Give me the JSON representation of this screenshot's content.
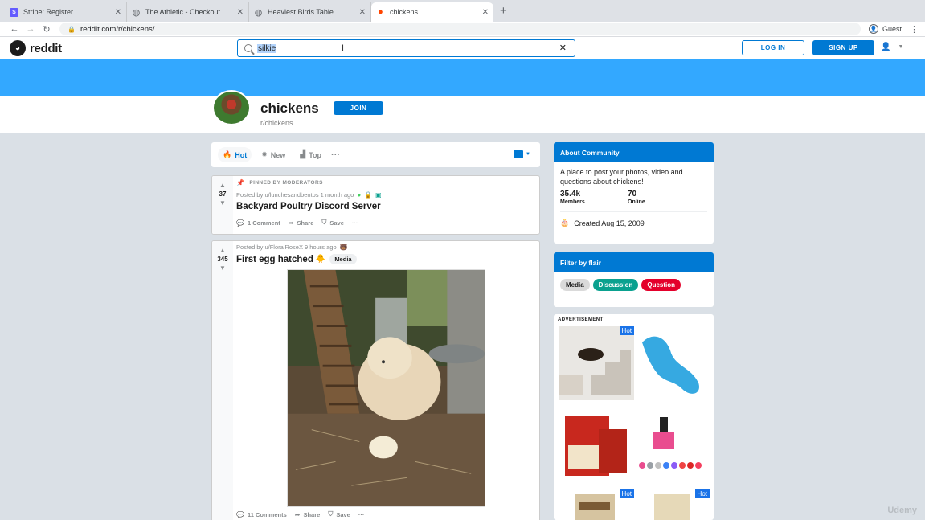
{
  "browser": {
    "tabs": [
      {
        "title": "Stripe: Register",
        "favicon_color": "#635bff",
        "favicon_glyph": "S"
      },
      {
        "title": "The Athletic - Checkout",
        "favicon_color": "#5f6368",
        "favicon_glyph": "◍"
      },
      {
        "title": "Heaviest Birds Table",
        "favicon_color": "#5f6368",
        "favicon_glyph": "◍"
      },
      {
        "title": "chickens",
        "favicon_color": "#ff4500",
        "favicon_glyph": "●",
        "active": true
      }
    ],
    "url": "reddit.com/r/chickens/",
    "profile_label": "Guest"
  },
  "reddit": {
    "logo_text": "reddit",
    "search_value": "silkie",
    "login_label": "LOG IN",
    "signup_label": "SIGN UP"
  },
  "community": {
    "name": "chickens",
    "subreddit": "r/chickens",
    "join_label": "JOIN",
    "banner_color": "#33a8ff"
  },
  "sort": {
    "items": [
      {
        "label": "Hot",
        "icon": "flame-icon",
        "active": true
      },
      {
        "label": "New",
        "icon": "sparkle-icon"
      },
      {
        "label": "Top",
        "icon": "bar-chart-icon"
      }
    ],
    "more": "···"
  },
  "posts": [
    {
      "pinned_label": "PINNED BY MODERATORS",
      "votes": "37",
      "meta": "Posted by u/lunchesandbentos 1 month ago",
      "title": "Backyard Poultry Discord Server",
      "actions": {
        "comments": "1 Comment",
        "share": "Share",
        "save": "Save",
        "more": "···"
      }
    },
    {
      "votes": "345",
      "meta": "Posted by u/FloralRoseX 9 hours ago",
      "title": "First egg hatched",
      "title_emoji": "🐥",
      "flair": "Media",
      "actions": {
        "comments": "11 Comments",
        "share": "Share",
        "save": "Save",
        "more": "···"
      }
    }
  ],
  "sidebar": {
    "about": {
      "header": "About Community",
      "description": "A place to post your photos, video and questions about chickens!",
      "members_value": "35.4k",
      "members_label": "Members",
      "online_value": "70",
      "online_label": "Online",
      "created": "Created Aug 15, 2009"
    },
    "flair": {
      "header": "Filter by flair",
      "items": [
        {
          "label": "Media",
          "bg": "#dadada",
          "fg": "#1c1c1c"
        },
        {
          "label": "Discussion",
          "bg": "#0aa18f",
          "fg": "#ffffff"
        },
        {
          "label": "Question",
          "bg": "#e4002b",
          "fg": "#ffffff"
        }
      ]
    },
    "ad": {
      "label": "ADVERTISEMENT",
      "hot_label": "Hot"
    }
  },
  "watermark": "Udemy"
}
